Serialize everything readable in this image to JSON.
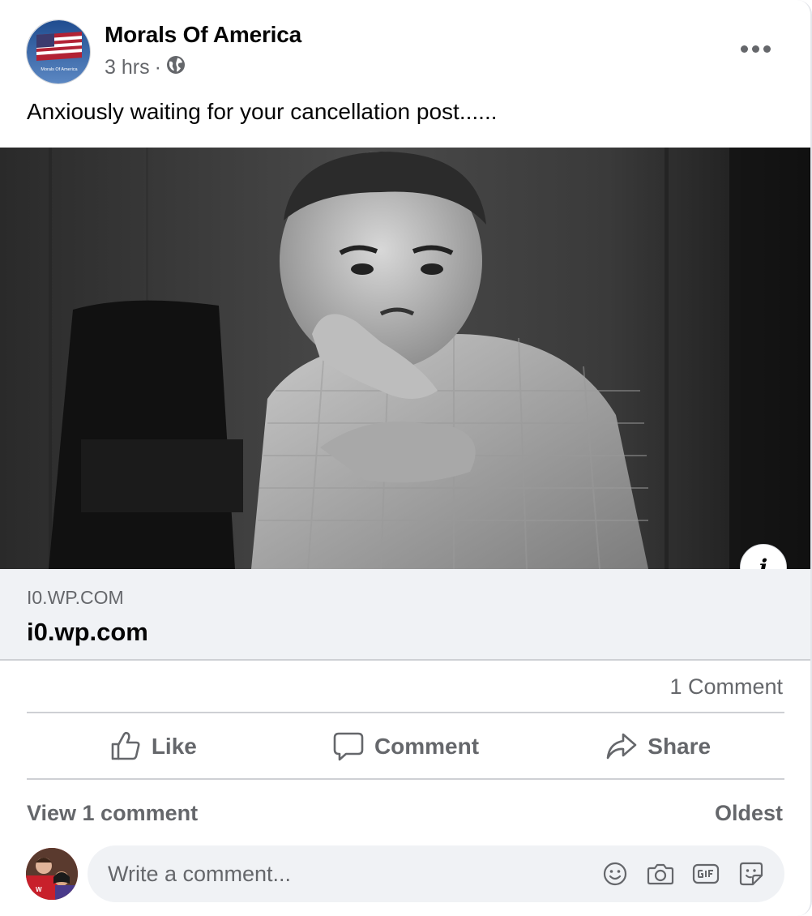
{
  "post": {
    "author": "Morals Of America",
    "avatar_text": "Morals Of America",
    "time": "3 hrs",
    "separator": "·",
    "privacy_icon": "globe-icon",
    "text": "Anxiously waiting for your cancellation post......"
  },
  "link": {
    "domain": "I0.WP.COM",
    "title": "i0.wp.com"
  },
  "counts": {
    "comments": "1 Comment"
  },
  "actions": {
    "like": "Like",
    "comment": "Comment",
    "share": "Share"
  },
  "comments": {
    "view_label": "View 1 comment",
    "sort_label": "Oldest",
    "input_placeholder": "Write a comment..."
  },
  "colors": {
    "secondary_text": "#65676b",
    "surface": "#f0f2f5",
    "divider": "#ced0d4"
  }
}
